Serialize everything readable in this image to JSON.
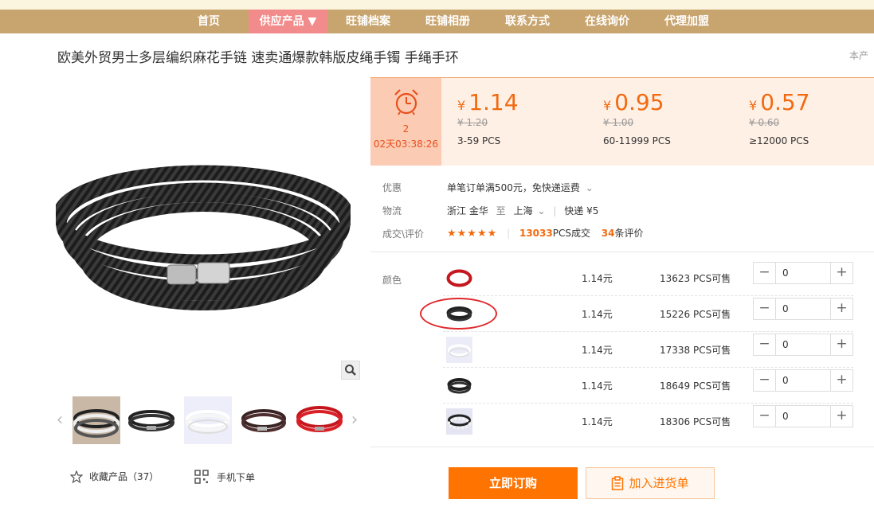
{
  "nav": {
    "items": [
      {
        "label": "首页"
      },
      {
        "label": "供应产品 ▼"
      },
      {
        "label": "旺铺档案"
      },
      {
        "label": "旺铺相册"
      },
      {
        "label": "联系方式"
      },
      {
        "label": "在线询价"
      },
      {
        "label": "代理加盟"
      }
    ],
    "active_index": 1
  },
  "product": {
    "title": "欧美外贸男士多层编织麻花手链 速卖通爆款韩版皮绳手镯 手绳手环",
    "notice": "本产"
  },
  "countdown": {
    "days_value": "2",
    "time_text": "02天03:38:26"
  },
  "price_tiers": [
    {
      "currency": "¥",
      "price": "1.14",
      "old": "¥ 1.20",
      "range": "3-59  PCS"
    },
    {
      "currency": "¥",
      "price": "0.95",
      "old": "¥ 1.00",
      "range": "60-11999  PCS"
    },
    {
      "currency": "¥",
      "price": "0.57",
      "old": "¥ 0.60",
      "range": "≥12000  PCS"
    }
  ],
  "promo": {
    "label": "优惠",
    "value": "单笔订单满500元，免快递运费"
  },
  "logistics": {
    "label": "物流",
    "from": "浙江 金华",
    "to_word": "至",
    "to": "上海",
    "method": "快递 ¥5"
  },
  "deal": {
    "label": "成交\\评价",
    "stars": "★★★★★",
    "volume": "13033",
    "volume_unit": "PCS成交",
    "reviews": "34",
    "reviews_unit": "条评价"
  },
  "variants": {
    "label": "颜色",
    "rows": [
      {
        "price": "1.14元",
        "stock": "13623 PCS可售",
        "qty": "0",
        "swatch": "red-braid"
      },
      {
        "price": "1.14元",
        "stock": "15226 PCS可售",
        "qty": "0",
        "swatch": "black-braid"
      },
      {
        "price": "1.14元",
        "stock": "17338 PCS可售",
        "qty": "0",
        "swatch": "white-braid"
      },
      {
        "price": "1.14元",
        "stock": "18649 PCS可售",
        "qty": "0",
        "swatch": "dark-braid"
      },
      {
        "price": "1.14元",
        "stock": "18306 PCS可售",
        "qty": "0",
        "swatch": "bw-braid"
      }
    ]
  },
  "actions": {
    "favorite": "收藏产品（37）",
    "mobile": "手机下单",
    "order": "立即订购",
    "cart": "加入进货单"
  },
  "colors": {
    "nav_bg": "#c8a46e",
    "nav_active": "#f28b8b",
    "accent": "#ff7300",
    "price": "#f26a10",
    "timer_bg": "#fbcbb3"
  }
}
